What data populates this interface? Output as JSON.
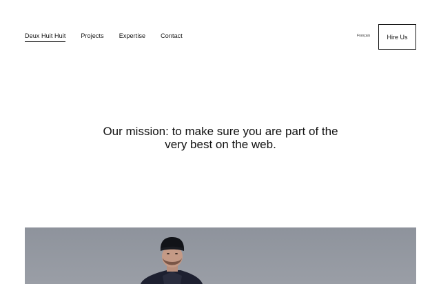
{
  "nav": {
    "brand": "Deux Huit Huit",
    "items": [
      "Projects",
      "Expertise",
      "Contact"
    ]
  },
  "header": {
    "language": "Français",
    "hire_label": "Hire Us"
  },
  "mission": {
    "line1": "Our mission: to make sure you are part of the",
    "line2": "very best on the web."
  },
  "colors": {
    "text": "#111111",
    "background": "#ffffff",
    "hero_backdrop": "#959aa2"
  }
}
